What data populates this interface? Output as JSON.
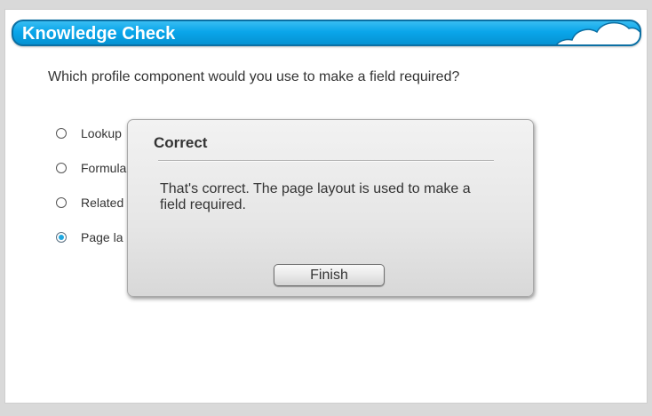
{
  "header": {
    "title": "Knowledge Check",
    "decoration_icon": "cloud-icon"
  },
  "question": {
    "text": "Which profile component would you use to make a field required?"
  },
  "options": [
    {
      "label": "Lookup",
      "selected": false
    },
    {
      "label": "Formula",
      "selected": false
    },
    {
      "label": "Related",
      "selected": false
    },
    {
      "label": "Page la",
      "selected": true
    }
  ],
  "dialog": {
    "title": "Correct",
    "message": "That's correct. The page layout is used to make a field required.",
    "finish_label": "Finish"
  },
  "colors": {
    "title_bar": "#0aa6ea",
    "title_bar_border": "#0b6fa3",
    "radio_selected": "#1fa8e0",
    "text": "#333333"
  }
}
